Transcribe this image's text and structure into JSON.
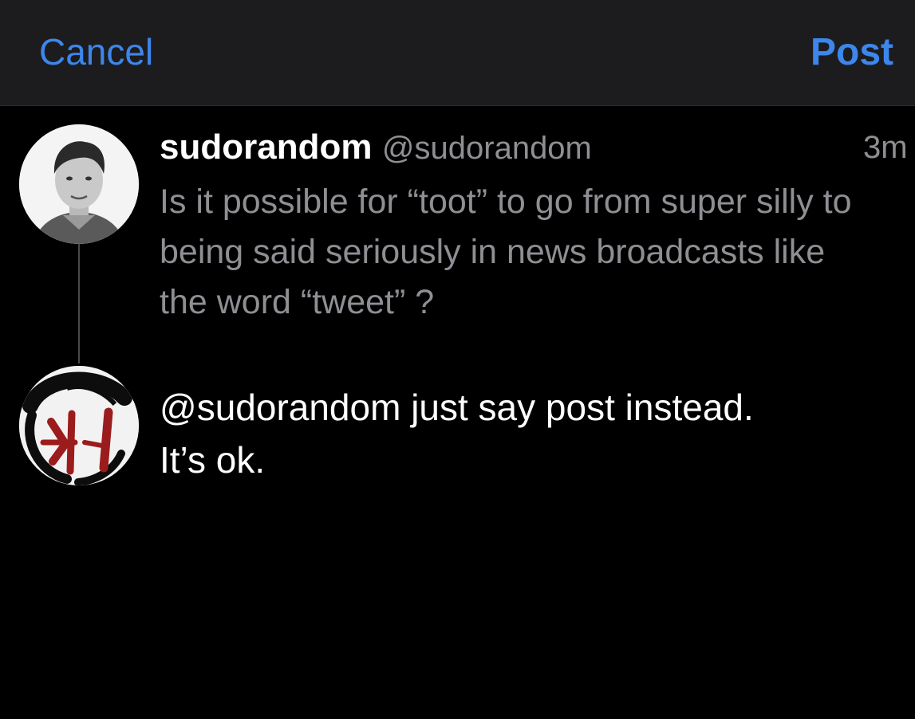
{
  "topbar": {
    "cancel_label": "Cancel",
    "post_label": "Post"
  },
  "original_post": {
    "display_name": "sudorandom",
    "handle": "@sudorandom",
    "timestamp": "3m",
    "text": "Is it possible for “toot” to go from super silly to being said seriously in news broadcasts like the word “tweet” ?"
  },
  "reply": {
    "text_line1": "@sudorandom just say post instead.",
    "text_line2": "It’s ok."
  },
  "colors": {
    "accent": "#3d86ec",
    "background": "#000000",
    "topbar": "#1c1c1e",
    "secondary_text": "#8e8e93"
  }
}
